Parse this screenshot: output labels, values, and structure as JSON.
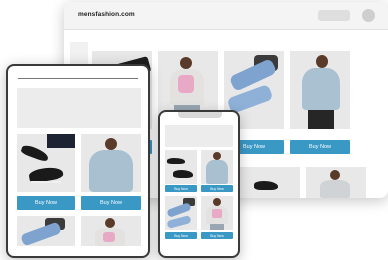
{
  "desktop": {
    "brand": "mensfashion.com",
    "button_label": "Buy Now"
  },
  "tablet": {
    "button_label": "Buy Now"
  },
  "phone": {
    "button_label": "Buy Now"
  }
}
